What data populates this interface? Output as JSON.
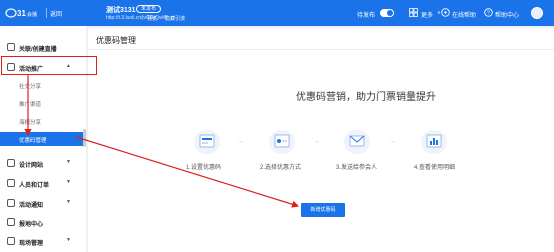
{
  "topbar": {
    "logo": "logo-icon",
    "back": "返回",
    "title": "测试3131",
    "status": "未发布",
    "url": "http://t.3.luoli.cn/jvCGrQwW",
    "link1": "预览",
    "link2": "隐藏引流",
    "pending": "待发布",
    "more": "更多",
    "chevron": "∨",
    "customer_service": "在线帮助",
    "help": "帮助中心"
  },
  "sidebar": {
    "items": [
      {
        "label": "关联/创建直播",
        "icon": "live-icon"
      },
      {
        "label": "活动推广",
        "icon": "promotion-icon",
        "arrow": "▲"
      },
      {
        "label": "设计网站",
        "icon": "design-icon",
        "arrow": "▼"
      },
      {
        "label": "人员和订单",
        "icon": "people-icon",
        "arrow": "▼"
      },
      {
        "label": "活动通知",
        "icon": "notice-icon",
        "arrow": "▼"
      },
      {
        "label": "报地中心",
        "icon": "center-icon"
      },
      {
        "label": "现场管理",
        "icon": "site-icon",
        "arrow": "▼"
      }
    ],
    "subitems": [
      {
        "label": "社交分享"
      },
      {
        "label": "推广渠道"
      },
      {
        "label": "海报分享"
      },
      {
        "label": "优惠码管理"
      }
    ]
  },
  "main": {
    "page_title": "优惠码管理",
    "hero": "优惠码营销，助力门票销量提升",
    "steps": [
      {
        "label": "1.设置优惠码"
      },
      {
        "label": "2.选择优惠方式"
      },
      {
        "label": "3.发送给参会人"
      },
      {
        "label": "4.查看使用明细"
      }
    ],
    "button": "新增优惠码"
  },
  "colors": {
    "brand": "#1a73e8",
    "annotation": "#e02020"
  }
}
